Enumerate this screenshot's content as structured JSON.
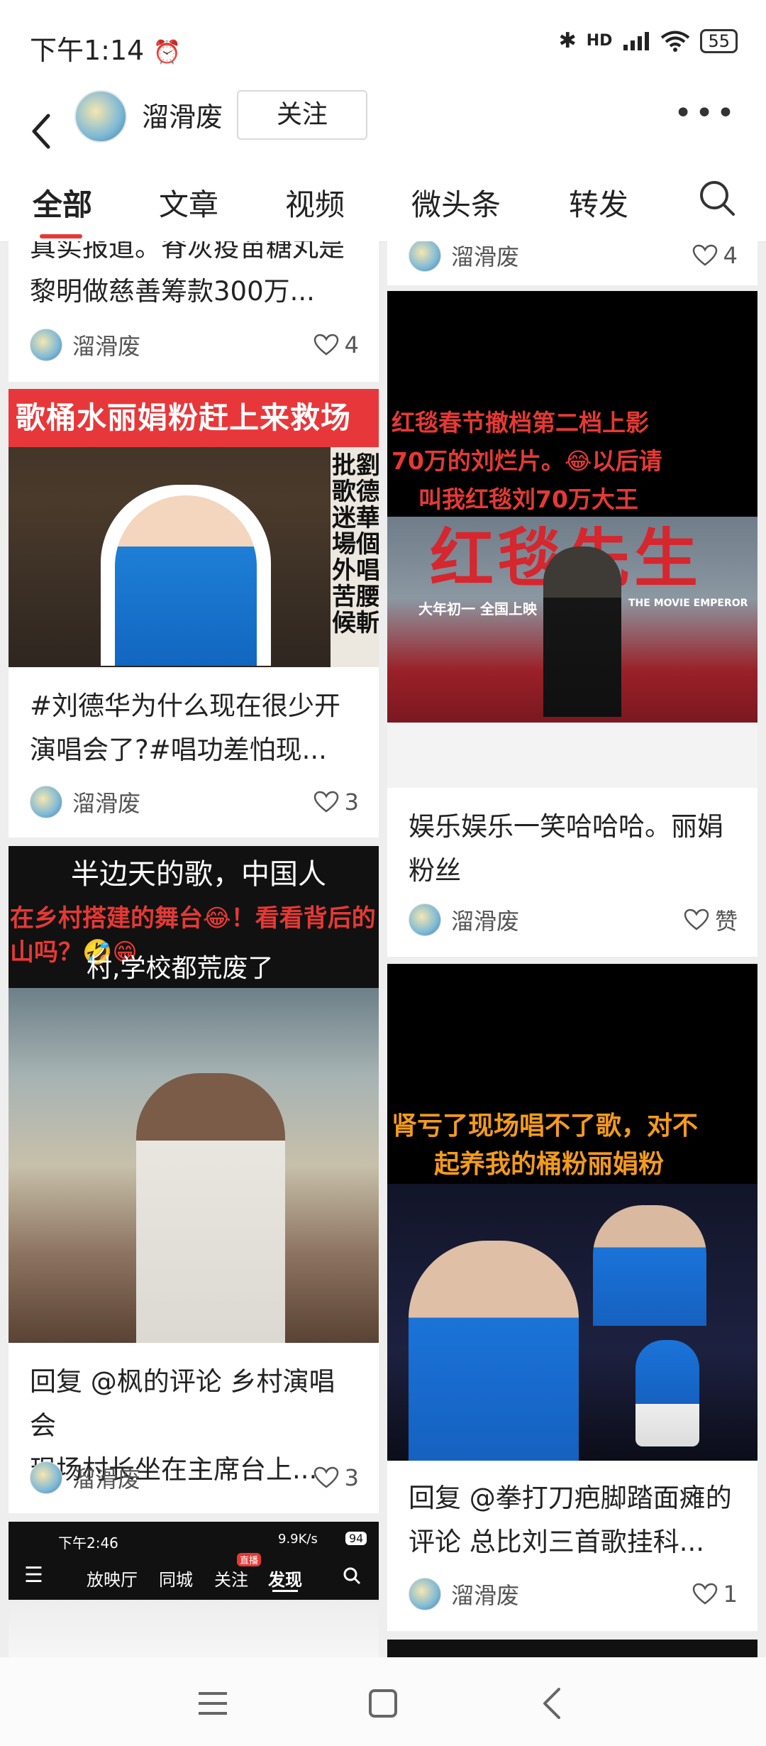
{
  "status": {
    "time": "下午1:14",
    "network": "HD",
    "battery": "55"
  },
  "header": {
    "author": "溜滑废",
    "follow_label": "关注"
  },
  "tabs": [
    "全部",
    "文章",
    "视频",
    "微头条",
    "转发"
  ],
  "cards": {
    "left_top": {
      "text_line1": "真实报道。脊灰疫苗糖丸是",
      "text_line2": "黎明做慈善筹款300万...",
      "author": "溜滑废",
      "likes": "4"
    },
    "left_2": {
      "banner": "歌桶水丽娟粉赶上来救场",
      "side_text": "批劉\n歌德\n迷華\n場個\n外唱\n苦腰\n候斬",
      "text_line1": "#刘德华为什么现在很少开",
      "text_line2": "演唱会了?#唱功差怕现...",
      "author": "溜滑废",
      "likes": "3"
    },
    "left_3": {
      "top_text": "半边天的歌，中国人",
      "red_text": "在乡村搭建的舞台😂！看看背后的山吗？🤣😁",
      "sub_text": "村,学校都荒废了",
      "text_line1": "回复 @枫的评论 乡村演唱会",
      "text_line2": "现场村长坐在主席台上...",
      "author": "溜滑废",
      "likes": "3"
    },
    "left_4": {
      "time": "下午2:46",
      "speed": "9.9K/s",
      "battery": "94",
      "nav": [
        "放映厅",
        "同城",
        "关注",
        "发现"
      ],
      "badge": "直播"
    },
    "right_top": {
      "author": "溜滑废",
      "likes": "4"
    },
    "right_2": {
      "caption_line1": "红毯春节撤档第二档上影",
      "caption_line2": "70万的刘烂片。😂以后请",
      "caption_line3": "叫我红毯刘70万大王",
      "poster_title": "红毯先生",
      "poster_sub": "大年初一  全国上映",
      "poster_en": "THE MOVIE EMPEROR",
      "text_line1": "娱乐娱乐一笑哈哈哈。丽娟",
      "text_line2": "粉丝",
      "author": "溜滑废",
      "likes": "赞"
    },
    "right_3": {
      "caption_line1": "肾亏了现场唱不了歌，对不",
      "caption_line2": "起养我的桶粉丽娟粉",
      "text_line1": "回复 @拳打刀疤脚踏面瘫的",
      "text_line2": "评论 总比刘三首歌挂科...",
      "author": "溜滑废",
      "likes": "1"
    }
  },
  "colors": {
    "accent": "#e53935",
    "caption_red": "#e53935",
    "background": "#eeeeee"
  }
}
